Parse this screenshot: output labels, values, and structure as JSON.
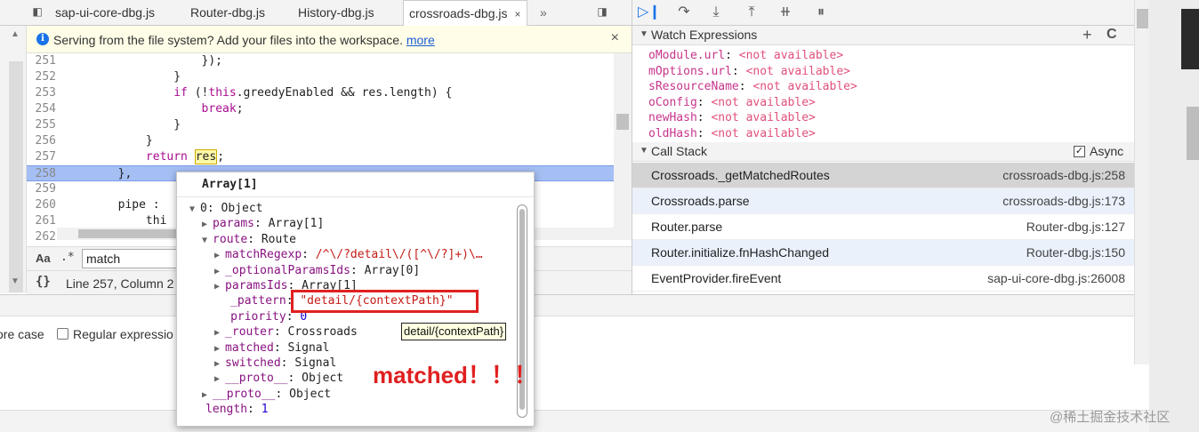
{
  "tabs": [
    {
      "label": "sap-ui-core-dbg.js"
    },
    {
      "label": "Router-dbg.js"
    },
    {
      "label": "History-dbg.js"
    },
    {
      "label": "crossroads-dbg.js",
      "close": "×"
    }
  ],
  "tabs_overflow": "»",
  "infobar": {
    "message": "Serving from the file system? Add your files into the workspace. ",
    "link": "more",
    "close": "×"
  },
  "code_lines": [
    {
      "num": "251",
      "text": "                    });"
    },
    {
      "num": "252",
      "text": "                }"
    },
    {
      "num": "253",
      "text": "                if (!this.greedyEnabled && res.length) {"
    },
    {
      "num": "254",
      "text": "                    break;"
    },
    {
      "num": "255",
      "text": "                }"
    },
    {
      "num": "256",
      "text": "            }"
    },
    {
      "num": "257",
      "text_before": "            return ",
      "highlight": "res",
      "text_after": ";"
    },
    {
      "num": "258",
      "text": "        },"
    },
    {
      "num": "259",
      "text": ""
    },
    {
      "num": "260",
      "text": "        pipe : "
    },
    {
      "num": "261",
      "text": "            thi"
    },
    {
      "num": "262",
      "text": "        "
    }
  ],
  "search": {
    "case_label": "Aa",
    "regex_label": ".*",
    "value": "match"
  },
  "status": {
    "braces": "{}",
    "position": "Line 257, Column 2"
  },
  "drawer": {
    "ignore_case_label": "ore case",
    "regex_label": "Regular expressio"
  },
  "debugger_toolbar": [
    "resume",
    "step-over",
    "step-into",
    "step-out",
    "deactivate-breakpoints",
    "pause-on-exceptions"
  ],
  "watch": {
    "title": "Watch Expressions",
    "add": "+",
    "refresh": "C",
    "items": [
      {
        "name": "oModule.url",
        "value": "<not available>"
      },
      {
        "name": "mOptions.url",
        "value": "<not available>"
      },
      {
        "name": "sResourceName",
        "value": "<not available>"
      },
      {
        "name": "oConfig",
        "value": "<not available>"
      },
      {
        "name": "newHash",
        "value": "<not available>"
      },
      {
        "name": "oldHash",
        "value": "<not available>"
      }
    ]
  },
  "call_stack": {
    "title": "Call Stack",
    "async_label": "Async",
    "async_checked": true,
    "frames": [
      {
        "fn": "Crossroads._getMatchedRoutes",
        "loc": "crossroads-dbg.js:258",
        "state": "selected"
      },
      {
        "fn": "Crossroads.parse",
        "loc": "crossroads-dbg.js:173",
        "state": "alt"
      },
      {
        "fn": "Router.parse",
        "loc": "Router-dbg.js:127",
        "state": "normal"
      },
      {
        "fn": "Router.initialize.fnHashChanged",
        "loc": "Router-dbg.js:150",
        "state": "alt"
      },
      {
        "fn": "EventProvider.fireEvent",
        "loc": "sap-ui-core-dbg.js:26008",
        "state": "normal"
      }
    ]
  },
  "popover": {
    "header": "Array[1]",
    "lines": [
      {
        "arrow": "▼",
        "indent": 0,
        "name": "0",
        "sep": ": ",
        "value": "Object",
        "vtype": "plain"
      },
      {
        "arrow": "▶",
        "indent": 1,
        "name": "params",
        "sep": ": ",
        "value": "Array[1]",
        "vtype": "plain"
      },
      {
        "arrow": "▼",
        "indent": 1,
        "name": "route",
        "sep": ": ",
        "value": "Route",
        "vtype": "plain"
      },
      {
        "arrow": "▶",
        "indent": 2,
        "name": "matchRegexp",
        "sep": ": ",
        "value": "/^\\/?detail\\/([^\\/?]+)\\…",
        "vtype": "str"
      },
      {
        "arrow": "▶",
        "indent": 2,
        "name": "_optionalParamsIds",
        "sep": ": ",
        "value": "Array[0]",
        "vtype": "plain"
      },
      {
        "arrow": "▶",
        "indent": 2,
        "name": "paramsIds",
        "sep": ": ",
        "value": "Array[1]",
        "vtype": "plain"
      },
      {
        "arrow": "",
        "indent": 2,
        "name": "_pattern",
        "sep": ": ",
        "value": "\"detail/{contextPath}\"",
        "vtype": "str"
      },
      {
        "arrow": "",
        "indent": 2,
        "name": "priority",
        "sep": ": ",
        "value": "0",
        "vtype": "num"
      },
      {
        "arrow": "▶",
        "indent": 2,
        "name": "_router",
        "sep": ": ",
        "value": "Crossroads",
        "vtype": "plain"
      },
      {
        "arrow": "▶",
        "indent": 2,
        "name": "matched",
        "sep": ": ",
        "value": "Signal",
        "vtype": "plain"
      },
      {
        "arrow": "▶",
        "indent": 2,
        "name": "switched",
        "sep": ": ",
        "value": "Signal",
        "vtype": "plain"
      },
      {
        "arrow": "▶",
        "indent": 2,
        "name": "__proto__",
        "sep": ": ",
        "value": "Object",
        "vtype": "plain"
      },
      {
        "arrow": "▶",
        "indent": 1,
        "name": "__proto__",
        "sep": ": ",
        "value": "Object",
        "vtype": "plain"
      },
      {
        "arrow": "",
        "indent": 0,
        "name": "length",
        "sep": ": ",
        "value": "1",
        "vtype": "num"
      }
    ]
  },
  "tooltip": "detail/{contextPath}",
  "annotation": "matched！！！",
  "watermark": "@稀土掘金技术社区",
  "colors": {
    "selected_row": "#d4d4d4",
    "alt_row": "#eaf1fb",
    "exec_line": "#a5bff5",
    "annotation": "#e02020",
    "accent": "#1a73e8"
  }
}
